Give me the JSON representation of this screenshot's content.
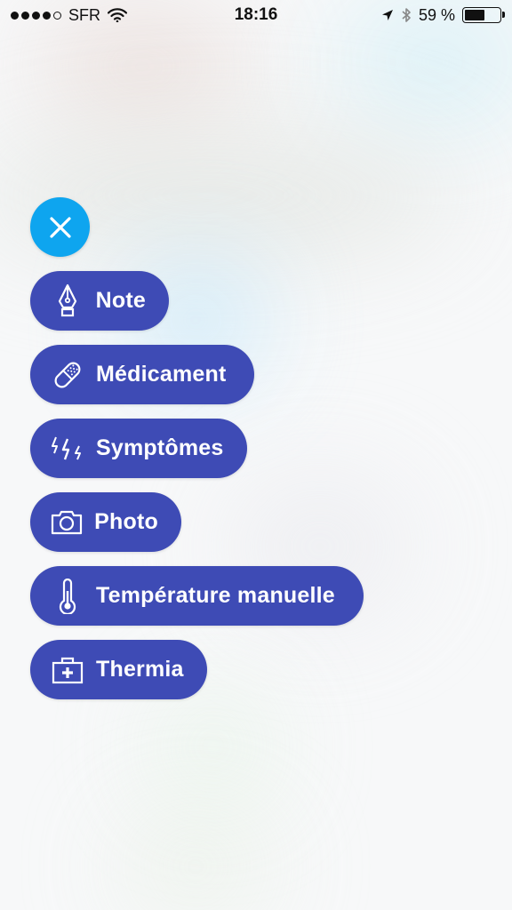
{
  "status_bar": {
    "carrier": "SFR",
    "time": "18:16",
    "battery_percent": "59 %",
    "battery_level": 0.59,
    "signal_bars_filled": 4,
    "signal_bars_total": 5,
    "icons": [
      "wifi-icon",
      "location-arrow-icon",
      "bluetooth-icon",
      "battery-icon"
    ]
  },
  "menu": {
    "accent_color": "#0ea5ef",
    "item_color": "#3e4bb5",
    "items": [
      {
        "label": "Note",
        "icon": "pen-nib-icon"
      },
      {
        "label": "Médicament",
        "icon": "pill-icon"
      },
      {
        "label": "Symptômes",
        "icon": "lightning-bolts-icon"
      },
      {
        "label": "Photo",
        "icon": "camera-icon"
      },
      {
        "label": "Température manuelle",
        "icon": "thermometer-icon"
      },
      {
        "label": "Thermia",
        "icon": "first-aid-kit-icon"
      }
    ]
  }
}
